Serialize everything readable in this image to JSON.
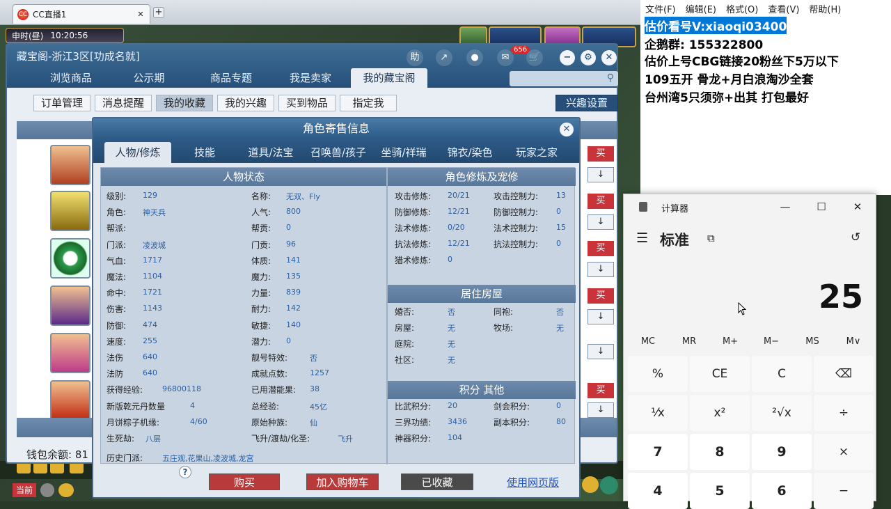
{
  "browser": {
    "tab_title": "CC直播1",
    "logo": "CC"
  },
  "game": {
    "time_label": "申时(昼)",
    "time_value": "10:20:56",
    "window_title": "藏宝阁-浙江3区[功成名就]",
    "badge_count": "656",
    "toolbar_help": "助",
    "nav_tabs": [
      "浏览商品",
      "公示期",
      "商品专题",
      "我是卖家",
      "我的藏宝阁"
    ],
    "sub_buttons": [
      "订单管理",
      "消息提醒",
      "我的收藏",
      "我的兴趣",
      "买到物品",
      "指定我"
    ],
    "interest_setting": "兴趣设置",
    "wallet_label": "钱包余额: 81",
    "buy_label": "买",
    "arrow_label": "↓",
    "bottom_label": "当前"
  },
  "modal": {
    "title": "角色寄售信息",
    "tabs": [
      "人物/修炼",
      "技能",
      "道具/法宝",
      "召唤兽/孩子",
      "坐骑/祥瑞",
      "锦衣/染色",
      "玩家之家"
    ],
    "section_status": "人物状态",
    "section_cultivation": "角色修炼及宠修",
    "section_house": "居住房屋",
    "section_score": "积分 其他",
    "status_left": [
      {
        "label": "级别:",
        "value": "129"
      },
      {
        "label": "角色:",
        "value": "神天兵"
      },
      {
        "label": "帮派:",
        "value": ""
      },
      {
        "label": "门派:",
        "value": "凌波城"
      },
      {
        "label": "气血:",
        "value": "1717"
      },
      {
        "label": "魔法:",
        "value": "1104"
      },
      {
        "label": "命中:",
        "value": "1721"
      },
      {
        "label": "伤害:",
        "value": "1143"
      },
      {
        "label": "防御:",
        "value": "474"
      },
      {
        "label": "速度:",
        "value": "255"
      },
      {
        "label": "法伤",
        "value": "640"
      },
      {
        "label": "法防",
        "value": "640"
      },
      {
        "label": "获得经验:",
        "value": "96800118"
      },
      {
        "label": "新版乾元丹数量",
        "value": "4"
      },
      {
        "label": "月饼粽子机缘:",
        "value": "4/60"
      },
      {
        "label": "生死劫:",
        "value": "八层"
      }
    ],
    "status_right": [
      {
        "label": "名称:",
        "value": "无双、Fly"
      },
      {
        "label": "人气:",
        "value": "800"
      },
      {
        "label": "帮贡:",
        "value": "0"
      },
      {
        "label": "门贡:",
        "value": "96"
      },
      {
        "label": "体质:",
        "value": "141"
      },
      {
        "label": "魔力:",
        "value": "135"
      },
      {
        "label": "力量:",
        "value": "839"
      },
      {
        "label": "耐力:",
        "value": "142"
      },
      {
        "label": "敏捷:",
        "value": "140"
      },
      {
        "label": "潜力:",
        "value": "0"
      },
      {
        "label": "靓号特效:",
        "value": "否"
      },
      {
        "label": "成就点数:",
        "value": "1257"
      },
      {
        "label": "已用潜能果:",
        "value": "38"
      },
      {
        "label": "总经验:",
        "value": "45亿"
      },
      {
        "label": "原始种族:",
        "value": "仙"
      },
      {
        "label": "飞升/渡劫/化圣:",
        "value": "飞升"
      }
    ],
    "history_label": "历史门派:",
    "history_value": "五庄观,花果山,凌波城,龙宫",
    "cultivation": [
      {
        "label": "攻击修炼:",
        "value": "20/21",
        "label2": "攻击控制力:",
        "value2": "13"
      },
      {
        "label": "防御修炼:",
        "value": "12/21",
        "label2": "防御控制力:",
        "value2": "0"
      },
      {
        "label": "法术修炼:",
        "value": "0/20",
        "label2": "法术控制力:",
        "value2": "15"
      },
      {
        "label": "抗法修炼:",
        "value": "12/21",
        "label2": "抗法控制力:",
        "value2": "0"
      },
      {
        "label": "猎术修炼:",
        "value": "0",
        "label2": "",
        "value2": ""
      }
    ],
    "house": [
      {
        "label": "婚否:",
        "value": "否",
        "label2": "同袍:",
        "value2": "否"
      },
      {
        "label": "房屋:",
        "value": "无",
        "label2": "牧场:",
        "value2": "无"
      },
      {
        "label": "庭院:",
        "value": "无",
        "label2": "",
        "value2": ""
      },
      {
        "label": "社区:",
        "value": "无",
        "label2": "",
        "value2": ""
      }
    ],
    "score": [
      {
        "label": "比武积分:",
        "value": "20",
        "label2": "剑会积分:",
        "value2": "0"
      },
      {
        "label": "三界功绩:",
        "value": "3436",
        "label2": "副本积分:",
        "value2": "80"
      },
      {
        "label": "神器积分:",
        "value": "104",
        "label2": "",
        "value2": ""
      }
    ],
    "btn_buy": "购买",
    "btn_cart": "加入购物车",
    "btn_collected": "已收藏",
    "btn_web": "使用网页版",
    "help_icon": "?"
  },
  "notepad": {
    "menu": [
      "文件(F)",
      "编辑(E)",
      "格式(O)",
      "查看(V)",
      "帮助(H)"
    ],
    "lines": [
      "估价看号V:xiaoqi03400",
      "企鹅群: 155322800",
      "估价上号CBG链接20粉丝下5万以下",
      "109五开 骨龙+月白浪淘沙全套",
      "台州湾5只须弥+出其 打包最好"
    ]
  },
  "calculator": {
    "title": "计算器",
    "mode": "标准",
    "display": "25",
    "memory": [
      "MC",
      "MR",
      "M+",
      "M−",
      "MS",
      "M∨"
    ],
    "keys": [
      "%",
      "CE",
      "C",
      "⌫",
      "¹⁄x",
      "x²",
      "²√x",
      "÷",
      "7",
      "8",
      "9",
      "×",
      "4",
      "5",
      "6",
      "−"
    ]
  },
  "colors": {
    "accent": "#2d5a86",
    "buy_red": "#c8343a",
    "selection": "#0078d7"
  }
}
